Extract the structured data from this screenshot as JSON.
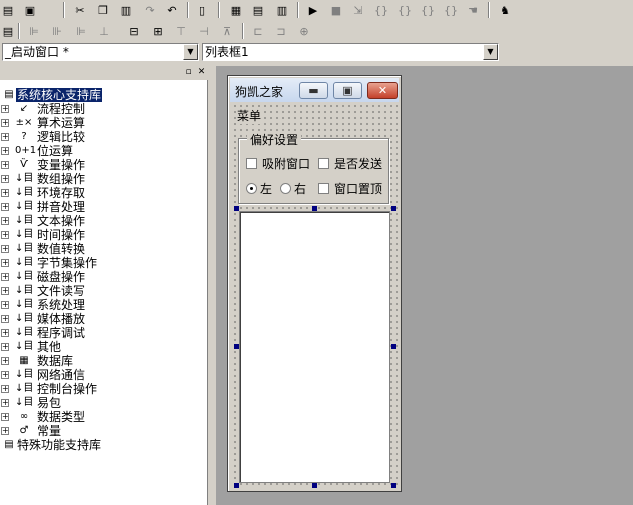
{
  "toolbar1": {
    "icons": [
      "save-icon",
      "save-all-icon",
      "cut-icon",
      "copy-icon",
      "paste-icon",
      "redo-icon",
      "undo-icon",
      "find-icon",
      "layout-icon",
      "layout2-icon",
      "layout3-icon",
      "run-icon",
      "stop-icon",
      "step-icon",
      "step-into-icon",
      "step-out-icon",
      "run-to-cursor-icon",
      "breakpoint-icon",
      "hand-icon",
      "debug-icon"
    ]
  },
  "toolbar2": {
    "icons": [
      "grid-icon",
      "align-left-icon",
      "align-center-icon",
      "align-right-icon",
      "align-top-icon",
      "align-middle-icon",
      "align-bottom-icon",
      "space-h-icon",
      "space-v-icon",
      "center-h-icon",
      "center-v-icon",
      "same-size-icon"
    ]
  },
  "combo_window": {
    "value": "_启动窗口 *"
  },
  "combo_control": {
    "value": "列表框1"
  },
  "tree": {
    "root_label": "系统核心支持库",
    "items": [
      {
        "icon": "↙",
        "label": "流程控制"
      },
      {
        "icon": "±×",
        "label": "算术运算"
      },
      {
        "icon": "?",
        "label": "逻辑比较"
      },
      {
        "icon": "0+1",
        "label": "位运算"
      },
      {
        "icon": "Ѷ",
        "label": "变量操作"
      },
      {
        "icon": "↓目",
        "label": "数组操作"
      },
      {
        "icon": "↓目",
        "label": "环境存取"
      },
      {
        "icon": "↓目",
        "label": "拼音处理"
      },
      {
        "icon": "↓目",
        "label": "文本操作"
      },
      {
        "icon": "↓目",
        "label": "时间操作"
      },
      {
        "icon": "↓目",
        "label": "数值转换"
      },
      {
        "icon": "↓目",
        "label": "字节集操作"
      },
      {
        "icon": "↓目",
        "label": "磁盘操作"
      },
      {
        "icon": "↓目",
        "label": "文件读写"
      },
      {
        "icon": "↓目",
        "label": "系统处理"
      },
      {
        "icon": "↓目",
        "label": "媒体播放"
      },
      {
        "icon": "↓目",
        "label": "程序调试"
      },
      {
        "icon": "↓目",
        "label": "其他"
      },
      {
        "icon": "▦",
        "label": "数据库"
      },
      {
        "icon": "↓目",
        "label": "网络通信"
      },
      {
        "icon": "↓目",
        "label": "控制台操作"
      },
      {
        "icon": "↓目",
        "label": "易包"
      },
      {
        "icon": "∞",
        "label": "数据类型"
      },
      {
        "icon": "♂",
        "label": "常量"
      }
    ],
    "second_root_label": "特殊功能支持库"
  },
  "form": {
    "title": "狗凯之家",
    "menu": "菜单",
    "group_title": "偏好设置",
    "chk_attach": "吸附窗口",
    "chk_send": "是否发送",
    "radio_left": "左",
    "radio_right": "右",
    "chk_topmost": "窗口置顶"
  }
}
